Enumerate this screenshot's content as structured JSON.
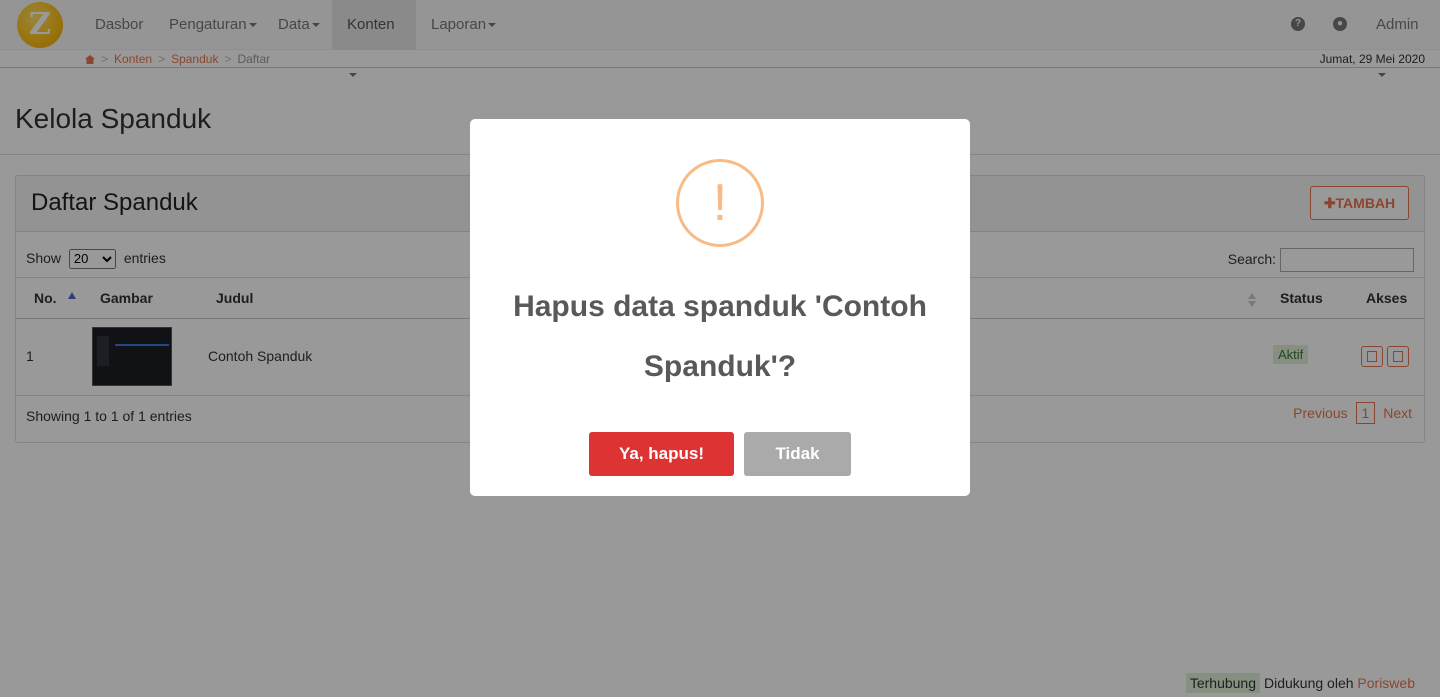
{
  "navbar": {
    "logo_letter": "Z",
    "items": [
      {
        "label": "Dasbor"
      },
      {
        "label": "Pengaturan"
      },
      {
        "label": "Data"
      },
      {
        "label": "Konten",
        "active": true
      },
      {
        "label": "Laporan"
      }
    ],
    "help_icon": "question-circle-icon",
    "lang_icon": "globe-icon",
    "user_label": "Admin"
  },
  "breadcrumb": {
    "home_icon": "home-icon",
    "items": [
      "Konten",
      "Spanduk",
      "Daftar"
    ],
    "separator": ">"
  },
  "date": "Jumat, 29 Mei 2020",
  "page": {
    "title": "Kelola Spanduk",
    "panel_title": "Daftar Spanduk",
    "add_button": "TAMBAH",
    "length_prefix": "Show",
    "length_value": "20",
    "length_suffix": "entries",
    "search_label": "Search:",
    "search_value": "",
    "columns": [
      "No.",
      "Gambar",
      "Judul",
      "Status",
      "Akses"
    ],
    "rows": [
      {
        "no": "1",
        "judul": "Contoh Spanduk",
        "status": "Aktif"
      }
    ],
    "info": "Showing 1 to 1 of 1 entries",
    "pagination": {
      "previous": "Previous",
      "current": "1",
      "next": "Next"
    }
  },
  "footer": {
    "status": "Terhubung",
    "powered_prefix": "Didukung oleh",
    "powered_brand": "Porisweb"
  },
  "modal": {
    "icon": "warning-icon",
    "icon_glyph": "!",
    "title": "Hapus data spanduk 'Contoh Spanduk'?",
    "confirm": "Ya, hapus!",
    "cancel": "Tidak"
  },
  "colors": {
    "accent": "#e8754f",
    "confirm": "#dd3333",
    "cancel": "#aaaaaa",
    "warning": "#f8bb86",
    "active_badge": "#dff0d8"
  }
}
